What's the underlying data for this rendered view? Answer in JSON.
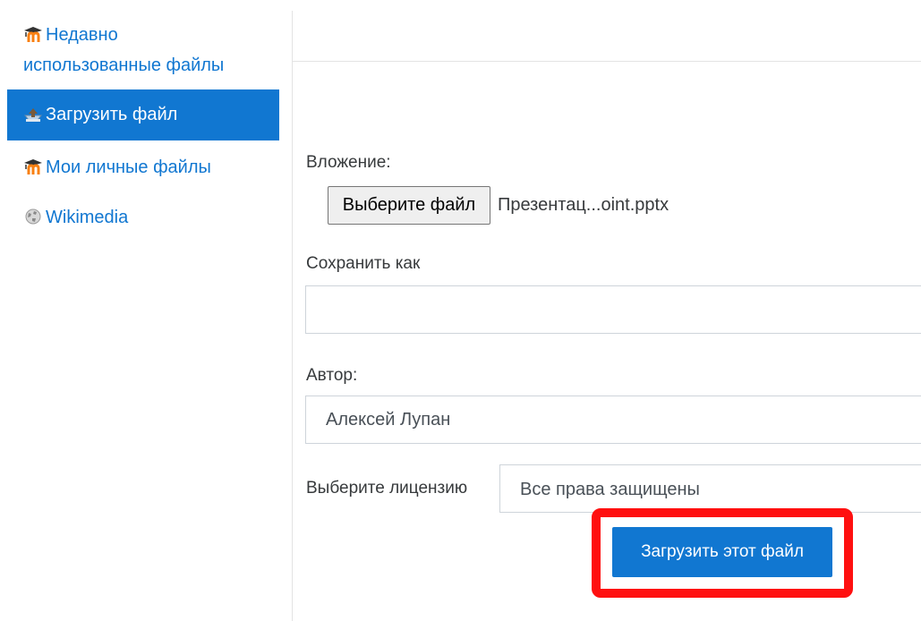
{
  "sidebar": {
    "items": [
      {
        "label_line1": "Недавно",
        "label_line2": "использованные файлы",
        "icon": "moodle-icon",
        "active": false
      },
      {
        "label": "Загрузить файл",
        "icon": "upload-icon",
        "active": true
      },
      {
        "label": "Мои личные файлы",
        "icon": "moodle-icon",
        "active": false
      },
      {
        "label": "Wikimedia",
        "icon": "wikimedia-icon",
        "active": false
      }
    ]
  },
  "form": {
    "attachment_label": "Вложение:",
    "choose_file_label": "Выберите файл",
    "file_name": "Презентац...oint.pptx",
    "save_as_label": "Сохранить как",
    "save_as_value": "",
    "author_label": "Автор:",
    "author_value": "Алексей Лупан",
    "license_label": "Выберите лицензию",
    "license_value": "Все права защищены",
    "upload_button_label": "Загрузить этот файл"
  },
  "colors": {
    "accent": "#1177d1",
    "highlight": "#ff1010",
    "moodle_orange": "#f98012"
  }
}
